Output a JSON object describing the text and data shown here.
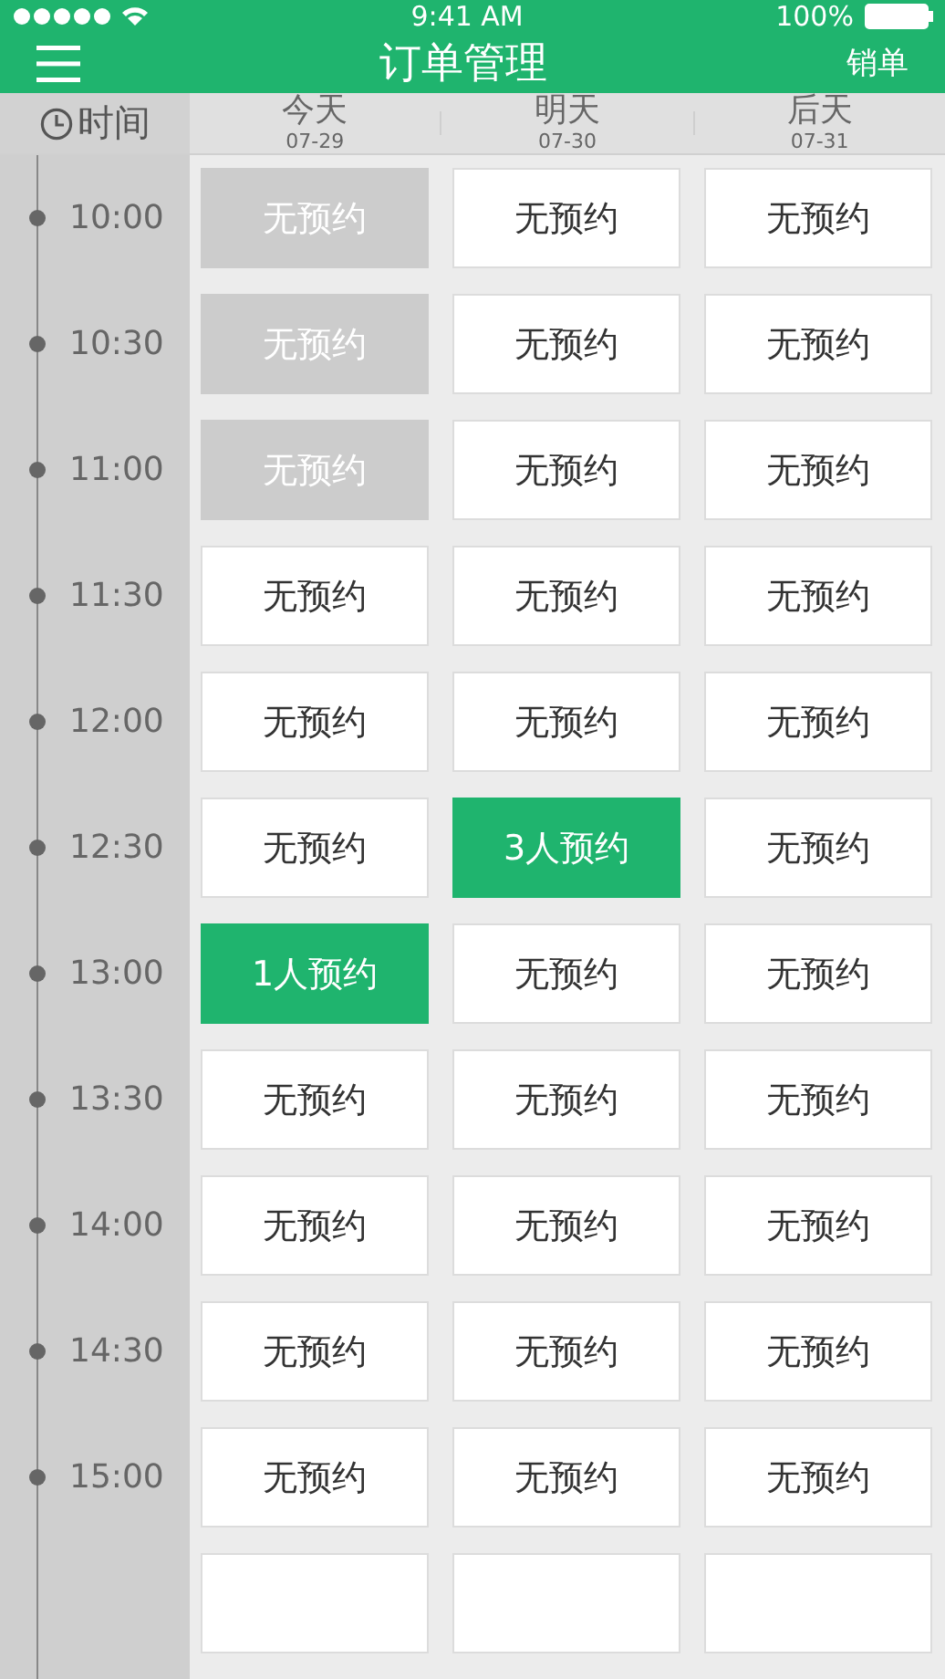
{
  "status_bar": {
    "time": "9:41 AM",
    "battery": "100%"
  },
  "nav": {
    "title": "订单管理",
    "action": "销单"
  },
  "header": {
    "time_label": "时间",
    "days": [
      {
        "name": "今天",
        "date": "07-29"
      },
      {
        "name": "明天",
        "date": "07-30"
      },
      {
        "name": "后天",
        "date": "07-31"
      }
    ]
  },
  "rows": [
    {
      "time": "10:00",
      "slots": [
        {
          "kind": "past",
          "label": "无预约"
        },
        {
          "kind": "empty",
          "label": "无预约"
        },
        {
          "kind": "empty",
          "label": "无预约"
        }
      ]
    },
    {
      "time": "10:30",
      "slots": [
        {
          "kind": "past",
          "label": "无预约"
        },
        {
          "kind": "empty",
          "label": "无预约"
        },
        {
          "kind": "empty",
          "label": "无预约"
        }
      ]
    },
    {
      "time": "11:00",
      "slots": [
        {
          "kind": "past",
          "label": "无预约"
        },
        {
          "kind": "empty",
          "label": "无预约"
        },
        {
          "kind": "empty",
          "label": "无预约"
        }
      ]
    },
    {
      "time": "11:30",
      "slots": [
        {
          "kind": "empty",
          "label": "无预约"
        },
        {
          "kind": "empty",
          "label": "无预约"
        },
        {
          "kind": "empty",
          "label": "无预约"
        }
      ]
    },
    {
      "time": "12:00",
      "slots": [
        {
          "kind": "empty",
          "label": "无预约"
        },
        {
          "kind": "empty",
          "label": "无预约"
        },
        {
          "kind": "empty",
          "label": "无预约"
        }
      ]
    },
    {
      "time": "12:30",
      "slots": [
        {
          "kind": "empty",
          "label": "无预约"
        },
        {
          "kind": "booked",
          "label": "3人预约"
        },
        {
          "kind": "empty",
          "label": "无预约"
        }
      ]
    },
    {
      "time": "13:00",
      "slots": [
        {
          "kind": "booked",
          "label": "1人预约"
        },
        {
          "kind": "empty",
          "label": "无预约"
        },
        {
          "kind": "empty",
          "label": "无预约"
        }
      ]
    },
    {
      "time": "13:30",
      "slots": [
        {
          "kind": "empty",
          "label": "无预约"
        },
        {
          "kind": "empty",
          "label": "无预约"
        },
        {
          "kind": "empty",
          "label": "无预约"
        }
      ]
    },
    {
      "time": "14:00",
      "slots": [
        {
          "kind": "empty",
          "label": "无预约"
        },
        {
          "kind": "empty",
          "label": "无预约"
        },
        {
          "kind": "empty",
          "label": "无预约"
        }
      ]
    },
    {
      "time": "14:30",
      "slots": [
        {
          "kind": "empty",
          "label": "无预约"
        },
        {
          "kind": "empty",
          "label": "无预约"
        },
        {
          "kind": "empty",
          "label": "无预约"
        }
      ]
    },
    {
      "time": "15:00",
      "slots": [
        {
          "kind": "empty",
          "label": "无预约"
        },
        {
          "kind": "empty",
          "label": "无预约"
        },
        {
          "kind": "empty",
          "label": "无预约"
        }
      ]
    },
    {
      "slots": [
        {
          "kind": "empty"
        },
        {
          "kind": "empty"
        },
        {
          "kind": "empty"
        }
      ]
    }
  ]
}
